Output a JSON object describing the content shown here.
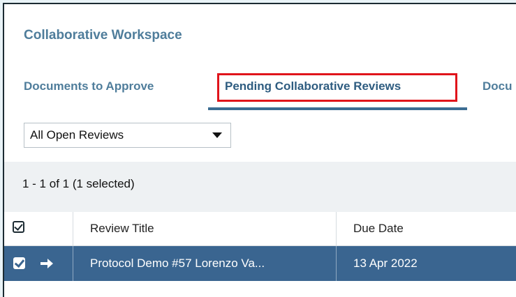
{
  "workspace": {
    "title": "Collaborative Workspace"
  },
  "tabs": [
    {
      "label": "Documents to Approve",
      "active": false
    },
    {
      "label": "Pending Collaborative Reviews",
      "active": true
    },
    {
      "label": "Docu",
      "active": false
    }
  ],
  "filter": {
    "selected": "All Open Reviews"
  },
  "summary": {
    "text": "1 - 1 of 1 (1 selected)"
  },
  "table": {
    "columns": [
      "Review Title",
      "Due Date"
    ],
    "rows": [
      {
        "title": "Protocol Demo #57 Lorenzo Va...",
        "due_date": "13 Apr 2022",
        "selected": true
      }
    ]
  },
  "colors": {
    "accent": "#4f7d9b",
    "selected_row": "#3a6590",
    "highlight": "#e0141b"
  }
}
